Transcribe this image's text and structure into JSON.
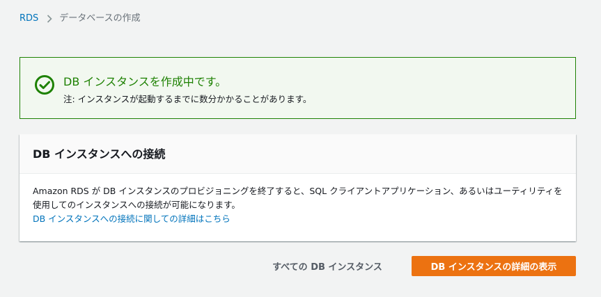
{
  "breadcrumb": {
    "root": "RDS",
    "current": "データベースの作成"
  },
  "flash": {
    "title": "DB インスタンスを作成中です。",
    "note": "注: インスタンスが起動するまでに数分かかることがあります。",
    "icon": "check-circle-icon",
    "color": "#1d8102"
  },
  "panel": {
    "title": "DB インスタンスへの接続",
    "body": "Amazon RDS が DB インスタンスのプロビジョニングを終了すると、SQL クライアントアプリケーション、あるいはユーティリティを使用してのインスタンスへの接続が可能になります。",
    "link": "DB インスタンスへの接続に関しての詳細はこちら"
  },
  "actions": {
    "all_instances": "すべての DB インスタンス",
    "view_details": "DB インスタンスの詳細の表示",
    "primary_color": "#ec7211"
  }
}
